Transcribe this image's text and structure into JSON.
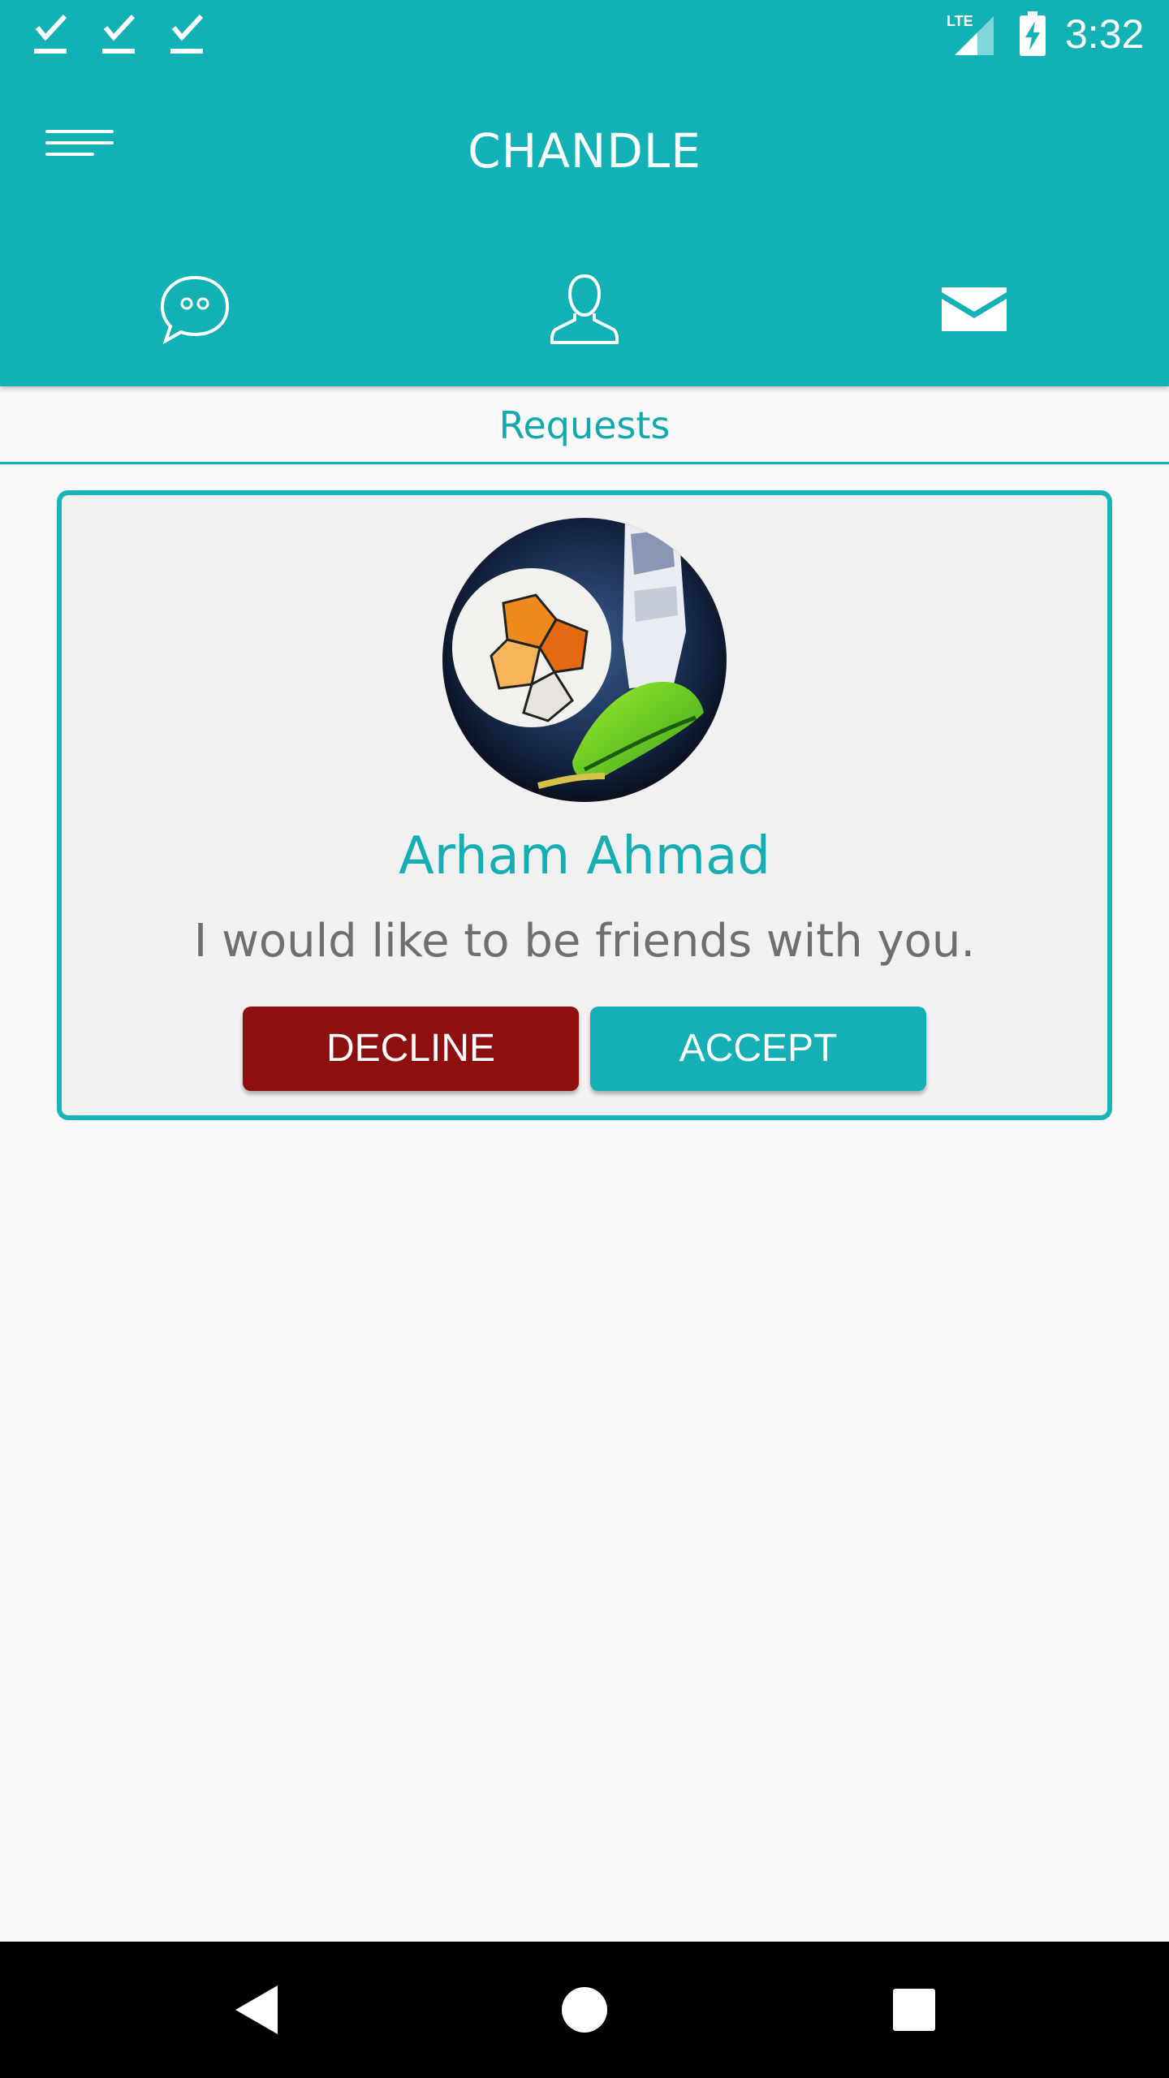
{
  "status_bar": {
    "time": "3:32",
    "network_label": "LTE",
    "notification_icons": [
      "check-download-icon",
      "check-download-icon",
      "check-download-icon"
    ]
  },
  "toolbar": {
    "title": "CHANDLE",
    "menu_icon": "menu-icon"
  },
  "tabs": [
    {
      "icon": "chat-bubble-icon"
    },
    {
      "icon": "person-icon"
    },
    {
      "icon": "envelope-icon",
      "selected": true
    }
  ],
  "section": {
    "title": "Requests"
  },
  "request": {
    "name": "Arham Ahmad",
    "message": "I would like to be friends with you.",
    "decline_label": "DECLINE",
    "accept_label": "ACCEPT"
  },
  "nav_bar": {
    "icons": [
      "back-icon",
      "home-icon",
      "recents-icon"
    ]
  },
  "colors": {
    "primary": "#11b1b6",
    "decline": "#8e0f0f",
    "background": "#f9f9f9",
    "card": "#f1f1f1",
    "message_text": "#6f6f6f"
  }
}
